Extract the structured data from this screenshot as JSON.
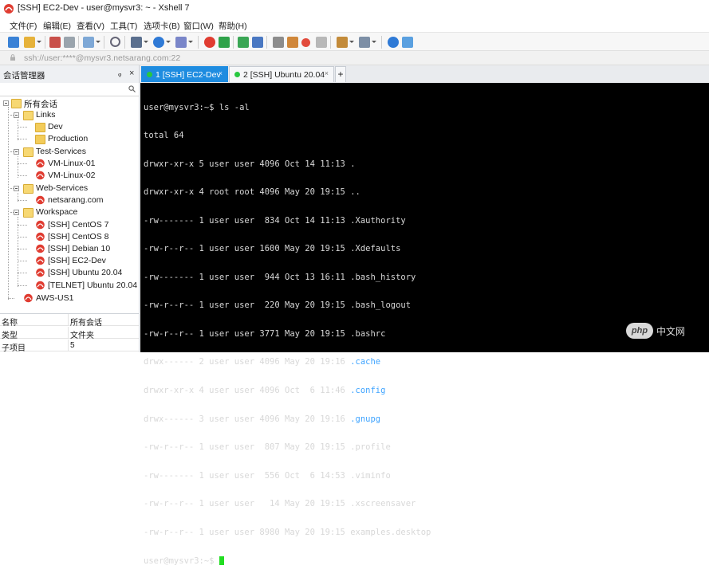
{
  "window": {
    "title": "[SSH] EC2-Dev - user@mysvr3: ~ - Xshell 7"
  },
  "menu": {
    "items": [
      "文件(F)",
      "编辑(E)",
      "查看(V)",
      "工具(T)",
      "选项卡(B)",
      "窗口(W)",
      "帮助(H)"
    ]
  },
  "address": {
    "value": "ssh://user:****@mysvr3.netsarang.com:22"
  },
  "session_manager": {
    "title": "会话管理器",
    "pin_glyph": "ᵩ",
    "close_glyph": "×",
    "search_placeholder": ""
  },
  "tree": {
    "root": "所有会话",
    "links": "Links",
    "dev": "Dev",
    "production": "Production",
    "test_services": "Test-Services",
    "vm1": "VM-Linux-01",
    "vm2": "VM-Linux-02",
    "web_services": "Web-Services",
    "netsarang": "netsarang.com",
    "workspace": "Workspace",
    "ws_items": [
      "[SSH] CentOS 7",
      "[SSH] CentOS 8",
      "[SSH] Debian 10",
      "[SSH] EC2-Dev",
      "[SSH] Ubuntu 20.04",
      "[TELNET] Ubuntu 20.04"
    ],
    "aws": "AWS-US1"
  },
  "properties": {
    "rows": [
      {
        "key": "名称",
        "value": "所有会话"
      },
      {
        "key": "类型",
        "value": "文件夹"
      },
      {
        "key": "子项目",
        "value": "5"
      }
    ]
  },
  "tabs": [
    {
      "label": "1 [SSH] EC2-Dev",
      "active": true
    },
    {
      "label": "2 [SSH] Ubuntu 20.04",
      "active": false
    }
  ],
  "tab_add": "+",
  "tab_close": "×",
  "terminal": {
    "prompt_cmd": "user@mysvr3:~$ ls -al",
    "total": "total 64",
    "entries": [
      {
        "meta": "drwxr-xr-x 5 user user 4096 Oct 14 11:13 ",
        "name": ".",
        "dir": false
      },
      {
        "meta": "drwxr-xr-x 4 root root 4096 May 20 19:15 ",
        "name": "..",
        "dir": false
      },
      {
        "meta": "-rw------- 1 user user  834 Oct 14 11:13 ",
        "name": ".Xauthority",
        "dir": false
      },
      {
        "meta": "-rw-r--r-- 1 user user 1600 May 20 19:15 ",
        "name": ".Xdefaults",
        "dir": false
      },
      {
        "meta": "-rw------- 1 user user  944 Oct 13 16:11 ",
        "name": ".bash_history",
        "dir": false
      },
      {
        "meta": "-rw-r--r-- 1 user user  220 May 20 19:15 ",
        "name": ".bash_logout",
        "dir": false
      },
      {
        "meta": "-rw-r--r-- 1 user user 3771 May 20 19:15 ",
        "name": ".bashrc",
        "dir": false
      },
      {
        "meta": "drwx------ 2 user user 4096 May 20 19:16 ",
        "name": ".cache",
        "dir": true
      },
      {
        "meta": "drwxr-xr-x 4 user user 4096 Oct  6 11:46 ",
        "name": ".config",
        "dir": true
      },
      {
        "meta": "drwx------ 3 user user 4096 May 20 19:16 ",
        "name": ".gnupg",
        "dir": true
      },
      {
        "meta": "-rw-r--r-- 1 user user  807 May 20 19:15 ",
        "name": ".profile",
        "dir": false
      },
      {
        "meta": "-rw------- 1 user user  556 Oct  6 14:53 ",
        "name": ".viminfo",
        "dir": false
      },
      {
        "meta": "-rw-r--r-- 1 user user   14 May 20 19:15 ",
        "name": ".xscreensaver",
        "dir": false
      },
      {
        "meta": "-rw-r--r-- 1 user user 8980 May 20 19:15 ",
        "name": "examples.desktop",
        "dir": false
      }
    ],
    "final_prompt": "user@mysvr3:~$ "
  },
  "watermark": {
    "badge": "php",
    "text": "中文网"
  },
  "colors": {
    "tab_active": "#1e8ce0",
    "dir_blue": "#3fa4ff",
    "cursor_green": "#22dd22",
    "session_red": "#e03c31"
  }
}
